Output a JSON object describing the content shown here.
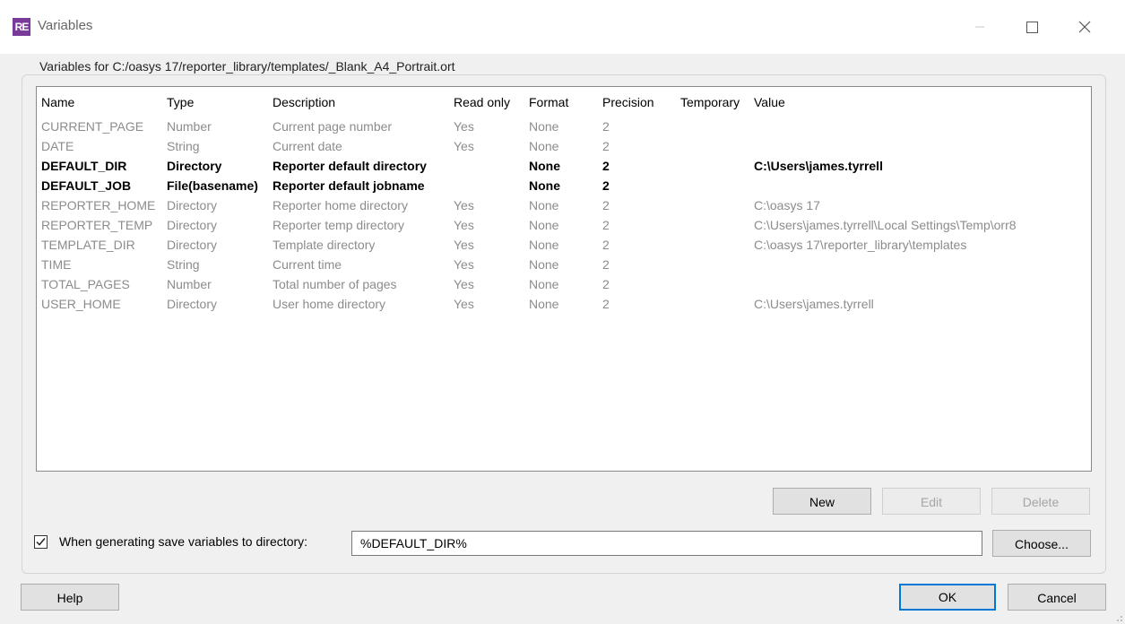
{
  "window": {
    "app_icon_text": "RE",
    "title": "Variables",
    "controls": {
      "minimize": "minimize-icon",
      "maximize": "maximize-icon",
      "close": "close-icon"
    }
  },
  "group": {
    "label": "Variables for C:/oasys 17/reporter_library/templates/_Blank_A4_Portrait.ort"
  },
  "table": {
    "columns": [
      "Name",
      "Type",
      "Description",
      "Read only",
      "Format",
      "Precision",
      "Temporary",
      "Value"
    ],
    "rows": [
      {
        "style": "dim",
        "cells": [
          "CURRENT_PAGE",
          "Number",
          "Current page number",
          "Yes",
          "None",
          "2",
          "",
          ""
        ]
      },
      {
        "style": "dim",
        "cells": [
          "DATE",
          "String",
          "Current date",
          "Yes",
          "None",
          "2",
          "",
          ""
        ]
      },
      {
        "style": "strong",
        "cells": [
          "DEFAULT_DIR",
          "Directory",
          "Reporter default directory",
          "",
          "None",
          "2",
          "",
          "C:\\Users\\james.tyrrell"
        ]
      },
      {
        "style": "strong",
        "cells": [
          "DEFAULT_JOB",
          "File(basename)",
          "Reporter default jobname",
          "",
          "None",
          "2",
          "",
          ""
        ]
      },
      {
        "style": "dim",
        "cells": [
          "REPORTER_HOME",
          "Directory",
          "Reporter home directory",
          "Yes",
          "None",
          "2",
          "",
          "C:\\oasys 17"
        ]
      },
      {
        "style": "dim",
        "cells": [
          "REPORTER_TEMP",
          "Directory",
          "Reporter temp directory",
          "Yes",
          "None",
          "2",
          "",
          "C:\\Users\\james.tyrrell\\Local Settings\\Temp\\orr8"
        ]
      },
      {
        "style": "dim",
        "cells": [
          "TEMPLATE_DIR",
          "Directory",
          "Template directory",
          "Yes",
          "None",
          "2",
          "",
          "C:\\oasys 17\\reporter_library\\templates"
        ]
      },
      {
        "style": "dim",
        "cells": [
          "TIME",
          "String",
          "Current time",
          "Yes",
          "None",
          "2",
          "",
          ""
        ]
      },
      {
        "style": "dim",
        "cells": [
          "TOTAL_PAGES",
          "Number",
          "Total number of pages",
          "Yes",
          "None",
          "2",
          "",
          ""
        ]
      },
      {
        "style": "dim",
        "cells": [
          "USER_HOME",
          "Directory",
          "User home directory",
          "Yes",
          "None",
          "2",
          "",
          "C:\\Users\\james.tyrrell"
        ]
      }
    ]
  },
  "buttons": {
    "new": "New",
    "edit": "Edit",
    "delete": "Delete",
    "choose": "Choose...",
    "help": "Help",
    "ok": "OK",
    "cancel": "Cancel"
  },
  "save_option": {
    "checked": true,
    "label": "When generating save variables to directory:",
    "value": "%DEFAULT_DIR%"
  },
  "colors": {
    "accent": "#0078d7",
    "app_icon": "#7a3a9a",
    "dim_text": "#8c8c8c"
  }
}
